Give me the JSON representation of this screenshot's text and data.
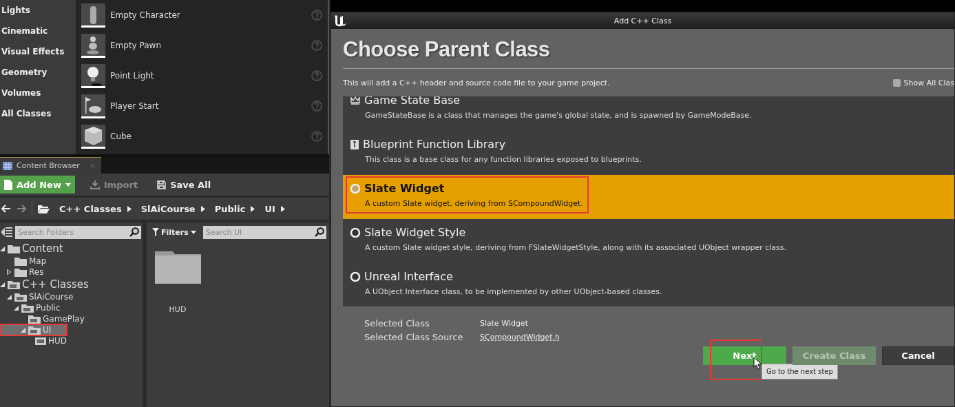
{
  "place_actors": {
    "categories": [
      "Lights",
      "Cinematic",
      "Visual Effects",
      "Geometry",
      "Volumes",
      "All Classes"
    ],
    "items": [
      {
        "label": "Empty Character",
        "kind": "character"
      },
      {
        "label": "Empty Pawn",
        "kind": "pawn"
      },
      {
        "label": "Point Light",
        "kind": "light"
      },
      {
        "label": "Player Start",
        "kind": "flag"
      },
      {
        "label": "Cube",
        "kind": "cube"
      }
    ]
  },
  "content_browser": {
    "tab": {
      "title": "Content Browser",
      "close": "×"
    },
    "toolbar": {
      "add_new": "Add New",
      "import": "Import",
      "save_all": "Save All"
    },
    "breadcrumb": [
      "C++ Classes",
      "SlAiCourse",
      "Public",
      "UI"
    ],
    "folder_search": {
      "placeholder": "Search Folders"
    },
    "filters": "Filters",
    "asset_search": {
      "placeholder": "Search UI"
    },
    "tree": [
      {
        "label": "Content",
        "kind": "folder",
        "expanded": true,
        "selected": false,
        "annotated": false,
        "children": [
          {
            "label": "Map",
            "kind": "folder",
            "selected": false,
            "annotated": false
          },
          {
            "label": "Res",
            "kind": "folder",
            "expanded": false,
            "selected": false,
            "annotated": false
          }
        ]
      },
      {
        "label": "C++ Classes",
        "kind": "cpp-folder",
        "expanded": true,
        "selected": false,
        "annotated": false,
        "children": [
          {
            "label": "SlAiCourse",
            "kind": "cpp-folder",
            "expanded": true,
            "selected": false,
            "annotated": false,
            "children": [
              {
                "label": "Public",
                "kind": "cpp-folder",
                "expanded": true,
                "selected": false,
                "annotated": false,
                "children": [
                  {
                    "label": "GamePlay",
                    "kind": "cpp-folder",
                    "selected": false,
                    "annotated": false
                  },
                  {
                    "label": "UI",
                    "kind": "cpp-folder",
                    "expanded": true,
                    "selected": true,
                    "annotated": true,
                    "children": [
                      {
                        "label": "HUD",
                        "kind": "cpp-file",
                        "selected": false,
                        "annotated": false
                      }
                    ]
                  }
                ]
              }
            ]
          }
        ]
      }
    ],
    "assets": [
      {
        "label": "HUD",
        "kind": "folder"
      }
    ]
  },
  "dialog": {
    "title": "Add C++ Class",
    "heading": "Choose Parent Class",
    "subtitle": "This will add a C++ header and source code file to your game project.",
    "show_all": {
      "label": "Show All Clas",
      "checked": false
    },
    "classes": [
      {
        "name": "Game State Base",
        "description": "GameStateBase is a class that manages the game's global state, and is spawned by GameModeBase.",
        "kind": "game-state",
        "selected": false,
        "annotated": false
      },
      {
        "name": "Blueprint Function Library",
        "description": "This class is a base class for any function libraries exposed to blueprints.",
        "kind": "function-library",
        "selected": false,
        "annotated": false
      },
      {
        "name": "Slate Widget",
        "description": "A custom Slate widget, deriving from SCompoundWidget.",
        "kind": "radio",
        "selected": true,
        "annotated": true
      },
      {
        "name": "Slate Widget Style",
        "description": "A custom Slate widget style, deriving from FSlateWidgetStyle, along with its associated UObject wrapper class.",
        "kind": "radio",
        "selected": false,
        "annotated": false
      },
      {
        "name": "Unreal Interface",
        "description": "A UObject Interface class, to be implemented by other UObject-based classes.",
        "kind": "radio",
        "selected": false,
        "annotated": false
      }
    ],
    "summary": [
      {
        "label": "Selected Class",
        "value": "Slate Widget",
        "kind": "text"
      },
      {
        "label": "Selected Class Source",
        "value": "SCompoundWidget.h",
        "kind": "link"
      }
    ],
    "buttons": [
      {
        "label": "Next",
        "kind": "primary",
        "disabled": false,
        "annotated": true
      },
      {
        "label": "Create Class",
        "kind": "primary",
        "disabled": true,
        "annotated": false
      },
      {
        "label": "Cancel",
        "kind": "secondary",
        "disabled": false,
        "annotated": false
      }
    ],
    "tooltip": "Go to the next step"
  }
}
